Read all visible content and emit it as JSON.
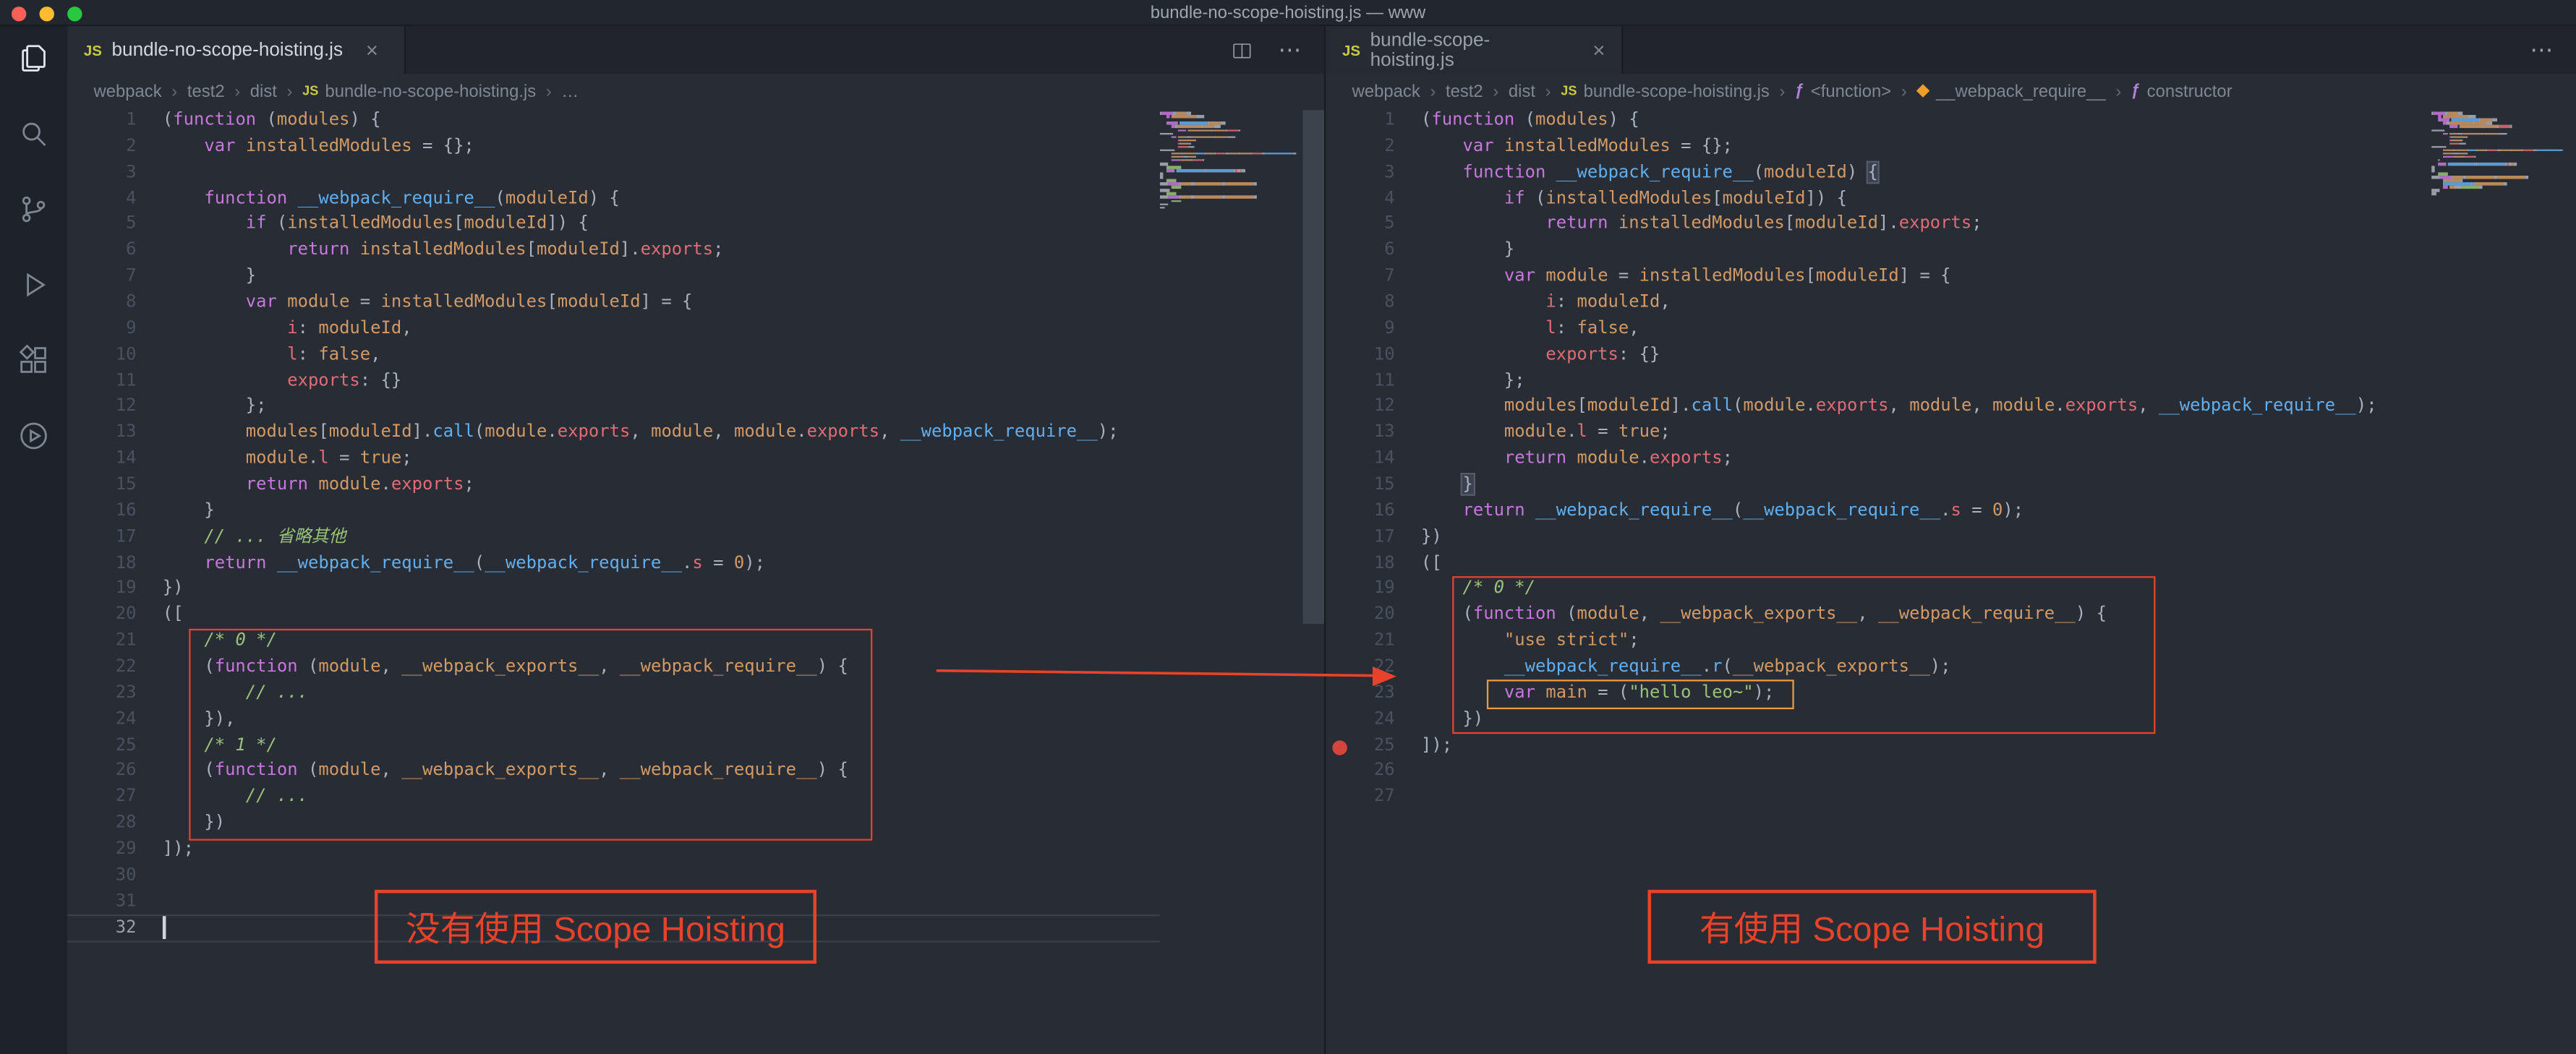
{
  "window": {
    "title": "bundle-no-scope-hoisting.js — www"
  },
  "colors": {
    "annotation_red": "#e8432a",
    "annotation_orange": "#eb9a3d",
    "breakpoint": "#d6443c",
    "traffic_red": "#ff5f57",
    "traffic_yellow": "#febc2e",
    "traffic_green": "#28c840"
  },
  "icons": {
    "close": "×",
    "more": "⋯",
    "js_badge": "JS",
    "breadcrumb_separator": "›",
    "symbol_function": "ƒ",
    "symbol_method": "◆",
    "symbol_constructor": "ƒ"
  },
  "activity_bar": {
    "items": [
      "explorer",
      "search",
      "source-control",
      "run-and-debug",
      "extensions",
      "run-circle"
    ]
  },
  "left_editor": {
    "tab_label": "bundle-no-scope-hoisting.js",
    "annotation_label": "没有使用 Scope Hoisting",
    "active_line": 32,
    "breadcrumb": [
      {
        "label": "webpack"
      },
      {
        "label": "test2"
      },
      {
        "label": "dist"
      },
      {
        "label": "bundle-no-scope-hoisting.js",
        "icon": "js"
      },
      {
        "label": "…"
      }
    ],
    "lines": [
      [
        [
          "p",
          "("
        ],
        [
          "k",
          "function"
        ],
        [
          "p",
          " ("
        ],
        [
          "v",
          "modules"
        ],
        [
          "p",
          ") {"
        ]
      ],
      [
        [
          "p",
          "    "
        ],
        [
          "k",
          "var"
        ],
        [
          "p",
          " "
        ],
        [
          "v",
          "installedModules"
        ],
        [
          "p",
          " = {};"
        ]
      ],
      [],
      [
        [
          "p",
          "    "
        ],
        [
          "k",
          "function"
        ],
        [
          "p",
          " "
        ],
        [
          "f",
          "__webpack_require__"
        ],
        [
          "p",
          "("
        ],
        [
          "v",
          "moduleId"
        ],
        [
          "p",
          ") {"
        ]
      ],
      [
        [
          "p",
          "        "
        ],
        [
          "k",
          "if"
        ],
        [
          "p",
          " ("
        ],
        [
          "v",
          "installedModules"
        ],
        [
          "p",
          "["
        ],
        [
          "v",
          "moduleId"
        ],
        [
          "p",
          "]) {"
        ]
      ],
      [
        [
          "p",
          "            "
        ],
        [
          "k",
          "return"
        ],
        [
          "p",
          " "
        ],
        [
          "v",
          "installedModules"
        ],
        [
          "p",
          "["
        ],
        [
          "v",
          "moduleId"
        ],
        [
          "p",
          "]."
        ],
        [
          "r",
          "exports"
        ],
        [
          "p",
          ";"
        ]
      ],
      [
        [
          "p",
          "        }"
        ]
      ],
      [
        [
          "p",
          "        "
        ],
        [
          "k",
          "var"
        ],
        [
          "p",
          " "
        ],
        [
          "v",
          "module"
        ],
        [
          "p",
          " = "
        ],
        [
          "v",
          "installedModules"
        ],
        [
          "p",
          "["
        ],
        [
          "v",
          "moduleId"
        ],
        [
          "p",
          "] = {"
        ]
      ],
      [
        [
          "p",
          "            "
        ],
        [
          "r",
          "i"
        ],
        [
          "p",
          ": "
        ],
        [
          "v",
          "moduleId"
        ],
        [
          "p",
          ","
        ]
      ],
      [
        [
          "p",
          "            "
        ],
        [
          "r",
          "l"
        ],
        [
          "p",
          ": "
        ],
        [
          "v",
          "false"
        ],
        [
          "p",
          ","
        ]
      ],
      [
        [
          "p",
          "            "
        ],
        [
          "r",
          "exports"
        ],
        [
          "p",
          ": {}"
        ]
      ],
      [
        [
          "p",
          "        };"
        ]
      ],
      [
        [
          "p",
          "        "
        ],
        [
          "v",
          "modules"
        ],
        [
          "p",
          "["
        ],
        [
          "v",
          "moduleId"
        ],
        [
          "p",
          "]."
        ],
        [
          "f",
          "call"
        ],
        [
          "p",
          "("
        ],
        [
          "v",
          "module"
        ],
        [
          "p",
          "."
        ],
        [
          "r",
          "exports"
        ],
        [
          "p",
          ", "
        ],
        [
          "v",
          "module"
        ],
        [
          "p",
          ", "
        ],
        [
          "v",
          "module"
        ],
        [
          "p",
          "."
        ],
        [
          "r",
          "exports"
        ],
        [
          "p",
          ", "
        ],
        [
          "f",
          "__webpack_require__"
        ],
        [
          "p",
          ");"
        ]
      ],
      [
        [
          "p",
          "        "
        ],
        [
          "v",
          "module"
        ],
        [
          "p",
          "."
        ],
        [
          "r",
          "l"
        ],
        [
          "p",
          " = "
        ],
        [
          "v",
          "true"
        ],
        [
          "p",
          ";"
        ]
      ],
      [
        [
          "p",
          "        "
        ],
        [
          "k",
          "return"
        ],
        [
          "p",
          " "
        ],
        [
          "v",
          "module"
        ],
        [
          "p",
          "."
        ],
        [
          "r",
          "exports"
        ],
        [
          "p",
          ";"
        ]
      ],
      [
        [
          "p",
          "    }"
        ]
      ],
      [
        [
          "p",
          "    "
        ],
        [
          "c",
          "// ... 省略其他"
        ]
      ],
      [
        [
          "p",
          "    "
        ],
        [
          "k",
          "return"
        ],
        [
          "p",
          " "
        ],
        [
          "f",
          "__webpack_require__"
        ],
        [
          "p",
          "("
        ],
        [
          "f",
          "__webpack_require__"
        ],
        [
          "p",
          "."
        ],
        [
          "r",
          "s"
        ],
        [
          "p",
          " = "
        ],
        [
          "v",
          "0"
        ],
        [
          "p",
          ");"
        ]
      ],
      [
        [
          "p",
          "})"
        ]
      ],
      [
        [
          "p",
          "(["
        ]
      ],
      [
        [
          "p",
          "    "
        ],
        [
          "c",
          "/* 0 */"
        ]
      ],
      [
        [
          "p",
          "    ("
        ],
        [
          "k",
          "function"
        ],
        [
          "p",
          " ("
        ],
        [
          "v",
          "module"
        ],
        [
          "p",
          ", "
        ],
        [
          "v",
          "__webpack_exports__"
        ],
        [
          "p",
          ", "
        ],
        [
          "v",
          "__webpack_require__"
        ],
        [
          "p",
          ") {"
        ]
      ],
      [
        [
          "p",
          "        "
        ],
        [
          "c",
          "// ..."
        ]
      ],
      [
        [
          "p",
          "    }),"
        ]
      ],
      [
        [
          "p",
          "    "
        ],
        [
          "c",
          "/* 1 */"
        ]
      ],
      [
        [
          "p",
          "    ("
        ],
        [
          "k",
          "function"
        ],
        [
          "p",
          " ("
        ],
        [
          "v",
          "module"
        ],
        [
          "p",
          ", "
        ],
        [
          "v",
          "__webpack_exports__"
        ],
        [
          "p",
          ", "
        ],
        [
          "v",
          "__webpack_require__"
        ],
        [
          "p",
          ") {"
        ]
      ],
      [
        [
          "p",
          "        "
        ],
        [
          "c",
          "// ..."
        ]
      ],
      [
        [
          "p",
          "    })"
        ]
      ],
      [
        [
          "p",
          "]);"
        ]
      ],
      [],
      [],
      []
    ]
  },
  "right_editor": {
    "tab_label": "bundle-scope-hoisting.js",
    "annotation_label": "有使用 Scope Hoisting",
    "breakpoint_line": 25,
    "breadcrumb": [
      {
        "label": "webpack"
      },
      {
        "label": "test2"
      },
      {
        "label": "dist"
      },
      {
        "label": "bundle-scope-hoisting.js",
        "icon": "js"
      },
      {
        "label": "<function>",
        "icon": "symbol-function"
      },
      {
        "label": "__webpack_require__",
        "icon": "symbol-method"
      },
      {
        "label": "constructor",
        "icon": "symbol-constructor"
      }
    ],
    "lines": [
      [
        [
          "p",
          "("
        ],
        [
          "k",
          "function"
        ],
        [
          "p",
          " ("
        ],
        [
          "v",
          "modules"
        ],
        [
          "p",
          ") {"
        ]
      ],
      [
        [
          "p",
          "    "
        ],
        [
          "k",
          "var"
        ],
        [
          "p",
          " "
        ],
        [
          "v",
          "installedModules"
        ],
        [
          "p",
          " = {};"
        ]
      ],
      [
        [
          "p",
          "    "
        ],
        [
          "k",
          "function"
        ],
        [
          "p",
          " "
        ],
        [
          "f",
          "__webpack_require__"
        ],
        [
          "p",
          "("
        ],
        [
          "v",
          "moduleId"
        ],
        [
          "p",
          ") "
        ],
        [
          "b",
          "{"
        ]
      ],
      [
        [
          "p",
          "        "
        ],
        [
          "k",
          "if"
        ],
        [
          "p",
          " ("
        ],
        [
          "v",
          "installedModules"
        ],
        [
          "p",
          "["
        ],
        [
          "v",
          "moduleId"
        ],
        [
          "p",
          "]) {"
        ]
      ],
      [
        [
          "p",
          "            "
        ],
        [
          "k",
          "return"
        ],
        [
          "p",
          " "
        ],
        [
          "v",
          "installedModules"
        ],
        [
          "p",
          "["
        ],
        [
          "v",
          "moduleId"
        ],
        [
          "p",
          "]."
        ],
        [
          "r",
          "exports"
        ],
        [
          "p",
          ";"
        ]
      ],
      [
        [
          "p",
          "        }"
        ]
      ],
      [
        [
          "p",
          "        "
        ],
        [
          "k",
          "var"
        ],
        [
          "p",
          " "
        ],
        [
          "v",
          "module"
        ],
        [
          "p",
          " = "
        ],
        [
          "v",
          "installedModules"
        ],
        [
          "p",
          "["
        ],
        [
          "v",
          "moduleId"
        ],
        [
          "p",
          "] = {"
        ]
      ],
      [
        [
          "p",
          "            "
        ],
        [
          "r",
          "i"
        ],
        [
          "p",
          ": "
        ],
        [
          "v",
          "moduleId"
        ],
        [
          "p",
          ","
        ]
      ],
      [
        [
          "p",
          "            "
        ],
        [
          "r",
          "l"
        ],
        [
          "p",
          ": "
        ],
        [
          "v",
          "false"
        ],
        [
          "p",
          ","
        ]
      ],
      [
        [
          "p",
          "            "
        ],
        [
          "r",
          "exports"
        ],
        [
          "p",
          ": {}"
        ]
      ],
      [
        [
          "p",
          "        };"
        ]
      ],
      [
        [
          "p",
          "        "
        ],
        [
          "v",
          "modules"
        ],
        [
          "p",
          "["
        ],
        [
          "v",
          "moduleId"
        ],
        [
          "p",
          "]."
        ],
        [
          "f",
          "call"
        ],
        [
          "p",
          "("
        ],
        [
          "v",
          "module"
        ],
        [
          "p",
          "."
        ],
        [
          "r",
          "exports"
        ],
        [
          "p",
          ", "
        ],
        [
          "v",
          "module"
        ],
        [
          "p",
          ", "
        ],
        [
          "v",
          "module"
        ],
        [
          "p",
          "."
        ],
        [
          "r",
          "exports"
        ],
        [
          "p",
          ", "
        ],
        [
          "f",
          "__webpack_require__"
        ],
        [
          "p",
          ");"
        ]
      ],
      [
        [
          "p",
          "        "
        ],
        [
          "v",
          "module"
        ],
        [
          "p",
          "."
        ],
        [
          "r",
          "l"
        ],
        [
          "p",
          " = "
        ],
        [
          "v",
          "true"
        ],
        [
          "p",
          ";"
        ]
      ],
      [
        [
          "p",
          "        "
        ],
        [
          "k",
          "return"
        ],
        [
          "p",
          " "
        ],
        [
          "v",
          "module"
        ],
        [
          "p",
          "."
        ],
        [
          "r",
          "exports"
        ],
        [
          "p",
          ";"
        ]
      ],
      [
        [
          "p",
          "    "
        ],
        [
          "b",
          "}"
        ]
      ],
      [
        [
          "p",
          "    "
        ],
        [
          "k",
          "return"
        ],
        [
          "p",
          " "
        ],
        [
          "f",
          "__webpack_require__"
        ],
        [
          "p",
          "("
        ],
        [
          "f",
          "__webpack_require__"
        ],
        [
          "p",
          "."
        ],
        [
          "r",
          "s"
        ],
        [
          "p",
          " = "
        ],
        [
          "v",
          "0"
        ],
        [
          "p",
          ");"
        ]
      ],
      [
        [
          "p",
          "})"
        ]
      ],
      [
        [
          "p",
          "(["
        ]
      ],
      [
        [
          "p",
          "    "
        ],
        [
          "c",
          "/* 0 */"
        ]
      ],
      [
        [
          "p",
          "    ("
        ],
        [
          "k",
          "function"
        ],
        [
          "p",
          " ("
        ],
        [
          "v",
          "module"
        ],
        [
          "p",
          ", "
        ],
        [
          "v",
          "__webpack_exports__"
        ],
        [
          "p",
          ", "
        ],
        [
          "v",
          "__webpack_require__"
        ],
        [
          "p",
          ") {"
        ]
      ],
      [
        [
          "p",
          "        "
        ],
        [
          "v",
          "\"use strict\""
        ],
        [
          "p",
          ";"
        ]
      ],
      [
        [
          "p",
          "        "
        ],
        [
          "f",
          "__webpack_require__"
        ],
        [
          "p",
          "."
        ],
        [
          "f",
          "r"
        ],
        [
          "p",
          "("
        ],
        [
          "v",
          "__webpack_exports__"
        ],
        [
          "p",
          ");"
        ]
      ],
      [
        [
          "p",
          "        "
        ],
        [
          "k",
          "var"
        ],
        [
          "p",
          " "
        ],
        [
          "v",
          "main"
        ],
        [
          "p",
          " = ("
        ],
        [
          "s",
          "\"hello leo~\""
        ],
        [
          "p",
          ");"
        ]
      ],
      [
        [
          "p",
          "    })"
        ]
      ],
      [
        [
          "p",
          "]);"
        ]
      ],
      [],
      []
    ]
  }
}
